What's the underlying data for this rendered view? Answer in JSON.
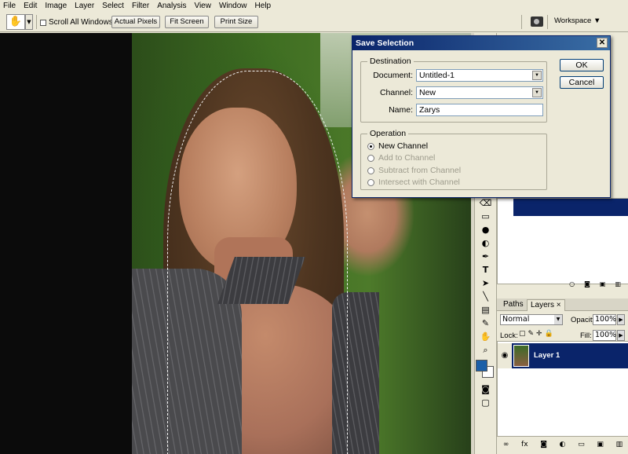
{
  "menu": [
    "File",
    "Edit",
    "Image",
    "Layer",
    "Select",
    "Filter",
    "Analysis",
    "View",
    "Window",
    "Help"
  ],
  "options": {
    "tool_icon": "hand-tool-icon",
    "scroll_all_windows": "Scroll All Windows",
    "actual_pixels": "Actual Pixels",
    "fit_screen": "Fit Screen",
    "print_size": "Print Size",
    "workspace": "Workspace ▼"
  },
  "dialog": {
    "title": "Save Selection",
    "close": "✕",
    "destination_title": "Destination",
    "document_label": "Document:",
    "document_value": "Untitled-1",
    "channel_label": "Channel:",
    "channel_value": "New",
    "name_label": "Name:",
    "name_value": "Zarys",
    "operation_title": "Operation",
    "operations": [
      "New Channel",
      "Add to Channel",
      "Subtract from Channel",
      "Intersect with Channel"
    ],
    "selected_operation": "New Channel",
    "ok": "OK",
    "cancel": "Cancel"
  },
  "layers_panel": {
    "tab_paths": "Paths",
    "tab_layers": "Layers",
    "tab_close": "×",
    "blend_mode": "Normal",
    "opacity_label": "Opacity:",
    "opacity_value": "100%",
    "lock_label": "Lock:",
    "fill_label": "Fill:",
    "fill_value": "100%",
    "layer_name": "Layer 1"
  },
  "colors": {
    "foreground": "#1b5fa8",
    "background": "#ffffff",
    "selection": "#0a246a"
  }
}
